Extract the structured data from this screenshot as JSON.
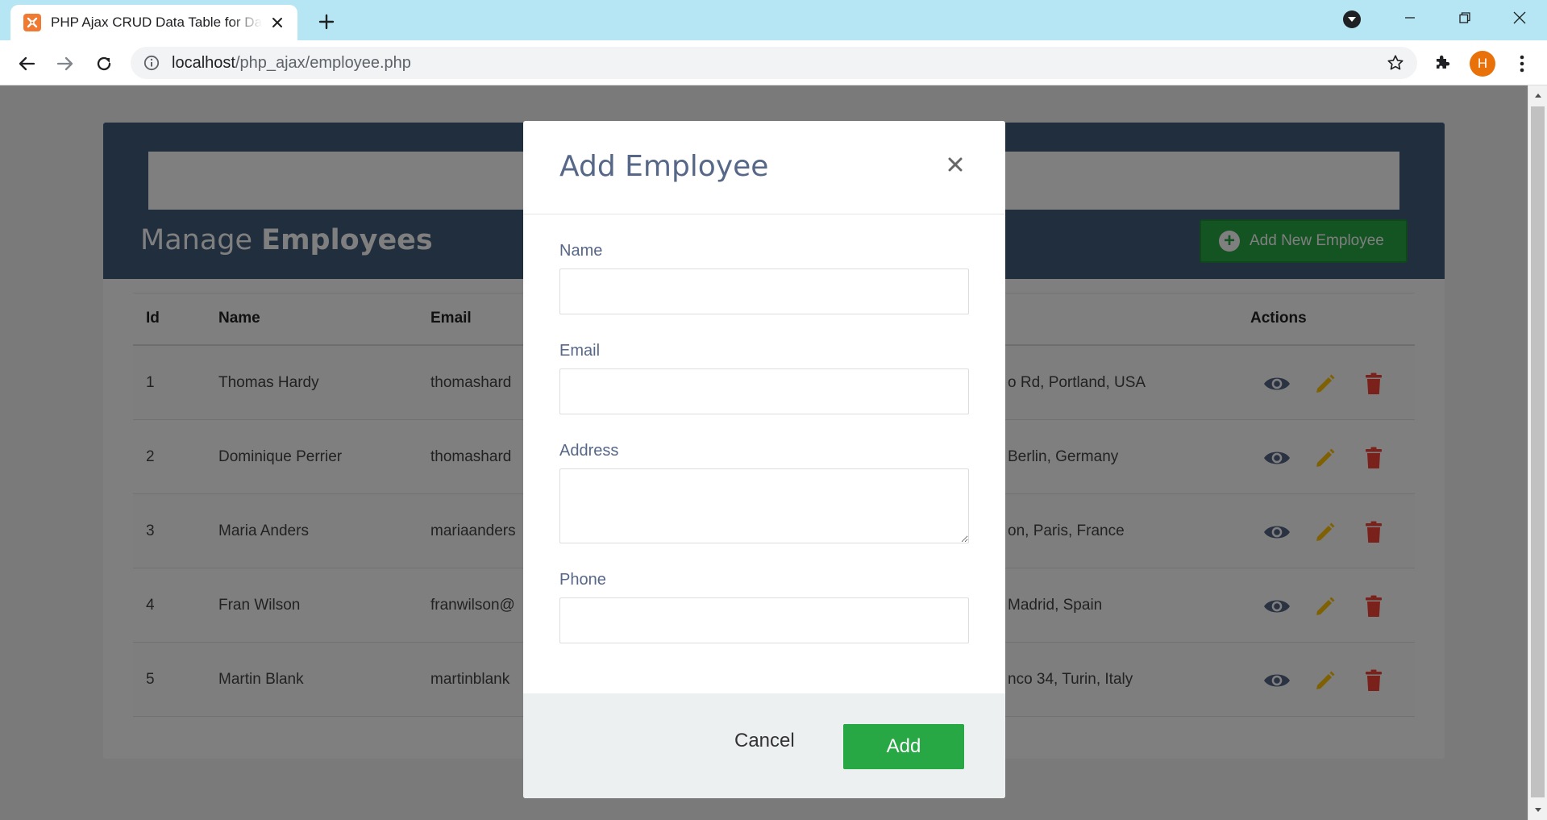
{
  "browser": {
    "tab_title": "PHP Ajax CRUD Data Table for Database",
    "url_host": "localhost",
    "url_path": "/php_ajax/employee.php",
    "profile_initial": "H"
  },
  "page": {
    "title_prefix": "Manage ",
    "title_bold": "Employees",
    "add_new_label": "Add New Employee"
  },
  "table": {
    "columns": [
      "Id",
      "Name",
      "Email",
      "Actions"
    ],
    "rows": [
      {
        "id": "1",
        "name": "Thomas Hardy",
        "email": "thomashard",
        "address": "o Rd, Portland, USA"
      },
      {
        "id": "2",
        "name": "Dominique Perrier",
        "email": "thomashard",
        "address": "Berlin, Germany"
      },
      {
        "id": "3",
        "name": "Maria Anders",
        "email": "mariaanders",
        "address": "on, Paris, France"
      },
      {
        "id": "4",
        "name": "Fran Wilson",
        "email": "franwilson@",
        "address": "Madrid, Spain"
      },
      {
        "id": "5",
        "name": "Martin Blank",
        "email": "martinblank",
        "address": "nco 34, Turin, Italy"
      }
    ]
  },
  "modal": {
    "title": "Add Employee",
    "fields": {
      "name_label": "Name",
      "email_label": "Email",
      "address_label": "Address",
      "phone_label": "Phone"
    },
    "cancel_label": "Cancel",
    "submit_label": "Add"
  },
  "colors": {
    "header_bg": "#435d7d",
    "success": "#28a745",
    "view_icon": "#566787",
    "edit_icon": "#FFC107",
    "delete_icon": "#F44336"
  },
  "icons": {
    "view": "eye-icon",
    "edit": "pencil-icon",
    "delete": "trash-icon"
  }
}
